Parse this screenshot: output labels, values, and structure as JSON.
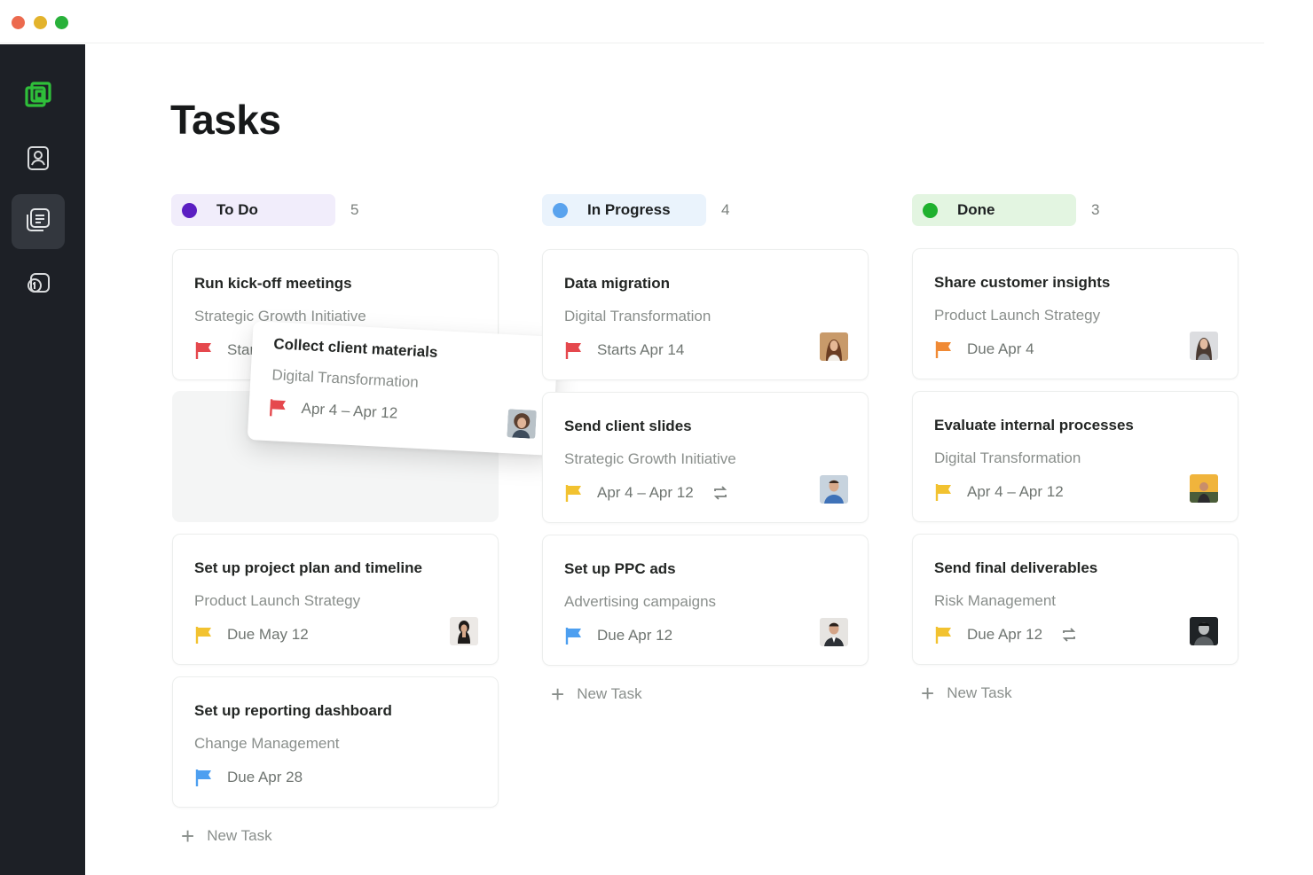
{
  "window": {
    "controls": [
      "close",
      "minimize",
      "maximize"
    ]
  },
  "sidebar": {
    "items": [
      {
        "icon": "logo-icon",
        "active": false
      },
      {
        "icon": "contacts-icon",
        "active": false
      },
      {
        "icon": "tasks-icon",
        "active": true
      },
      {
        "icon": "billing-icon",
        "active": false
      }
    ],
    "accent": "#2fbf3a"
  },
  "page": {
    "title": "Tasks"
  },
  "columns": [
    {
      "name": "To Do",
      "count": "5",
      "dot_color": "#5b1fc2",
      "pill_color": "#f1edfb"
    },
    {
      "name": "In Progress",
      "count": "4",
      "dot_color": "#5aa3ee",
      "pill_color": "#eaf3fc"
    },
    {
      "name": "Done",
      "count": "3",
      "dot_color": "#1fb12e",
      "pill_color": "#e3f5e1"
    }
  ],
  "cards": {
    "todo": [
      {
        "title": "Run kick-off meetings",
        "project": "Strategic Growth Initiative",
        "date": "Start",
        "flag": "red"
      },
      {
        "title": "Set up project plan and timeline",
        "project": "Product Launch Strategy",
        "date": "Due May 12",
        "flag": "yellow",
        "avatar": "woman-dark-hair"
      },
      {
        "title": "Set up reporting dashboard",
        "project": "Change Management",
        "date": "Due Apr 28",
        "flag": "blue"
      }
    ],
    "dragging": {
      "title": "Collect client materials",
      "project": "Digital Transformation",
      "date": "Apr 4 – Apr 12",
      "flag": "red",
      "avatar": "woman-curly-hair"
    },
    "in_progress": [
      {
        "title": "Data migration",
        "project": "Digital Transformation",
        "date": "Starts Apr 14",
        "flag": "red",
        "avatar": "woman-brown-hair"
      },
      {
        "title": "Send client slides",
        "project": "Strategic Growth Initiative",
        "date": "Apr 4 – Apr 12",
        "flag": "yellow",
        "repeat": true,
        "avatar": "man-blue-shirt"
      },
      {
        "title": "Set up PPC ads",
        "project": "Advertising campaigns",
        "date": "Due Apr 12",
        "flag": "blue",
        "avatar": "man-suit"
      }
    ],
    "done": [
      {
        "title": "Share customer insights",
        "project": "Product Launch Strategy",
        "date": "Due Apr 4",
        "flag": "orange",
        "avatar": "woman-long-hair"
      },
      {
        "title": "Evaluate internal processes",
        "project": "Digital Transformation",
        "date": "Apr 4 – Apr 12",
        "flag": "yellow",
        "avatar": "person-outdoor"
      },
      {
        "title": "Send final deliverables",
        "project": "Risk Management",
        "date": "Due Apr 12",
        "flag": "yellow",
        "repeat": true,
        "avatar": "man-dark-portrait"
      }
    ]
  },
  "new_task_label": "New Task",
  "flag_colors": {
    "red": "#e5484d",
    "yellow": "#f2c230",
    "orange": "#f08a35",
    "blue": "#4d9ff0"
  }
}
